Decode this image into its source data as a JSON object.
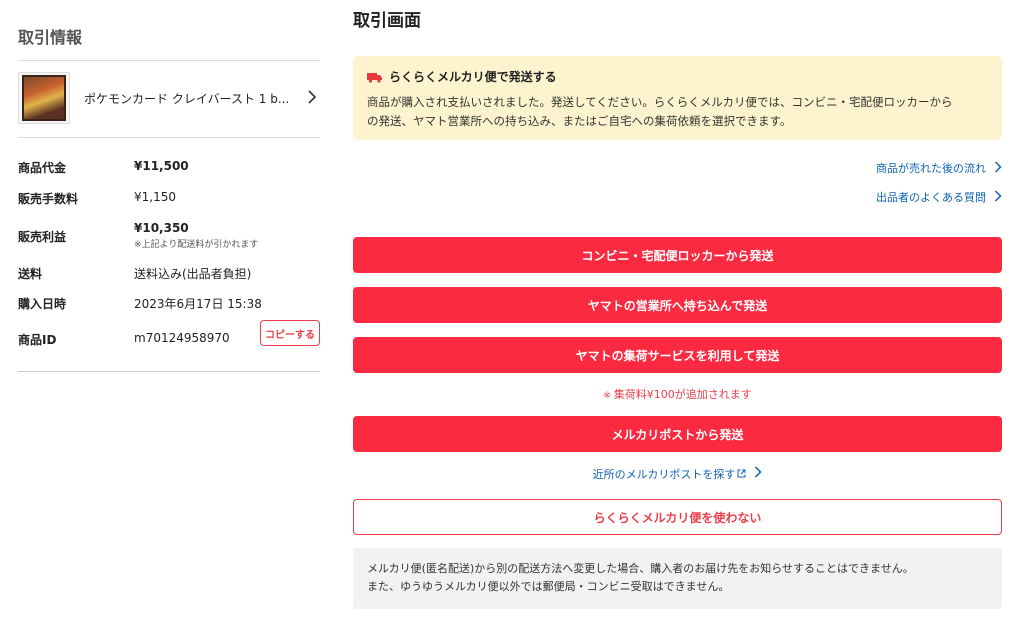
{
  "left": {
    "title": "取引情報",
    "product": {
      "name": "ポケモンカード クレイバースト 1 b...",
      "chevron": "chevron-right-icon"
    },
    "rows": {
      "price": {
        "label": "商品代金",
        "value": "¥11,500"
      },
      "fee": {
        "label": "販売手数料",
        "value": "¥1,150"
      },
      "profit": {
        "label": "販売利益",
        "value": "¥10,350",
        "note": "※上記より配送料が引かれます"
      },
      "shipping": {
        "label": "送料",
        "value": "送料込み(出品者負担)"
      },
      "purchase_date": {
        "label": "購入日時",
        "value": "2023年6月17日 15:38"
      },
      "item_id": {
        "label": "商品ID",
        "value": "m70124958970",
        "copy_label": "コピーする"
      }
    }
  },
  "right": {
    "title": "取引画面",
    "notice": {
      "icon": "truck-icon",
      "heading": "らくらくメルカリ便で発送する",
      "line1": "商品が購入され支払いされました。発送してください。らくらくメルカリ便では、コンビニ・宅配便ロッカーから",
      "line2": "の発送、ヤマト営業所への持ち込み、またはご自宅への集荷依頼を選択できます。"
    },
    "links": {
      "flow": "商品が売れた後の流れ",
      "faq": "出品者のよくある質問"
    },
    "buttons": {
      "convenience": "コンビニ・宅配便ロッカーから発送",
      "yamato_office": "ヤマトの営業所へ持ち込んで発送",
      "yamato_pickup": "ヤマトの集荷サービスを利用して発送",
      "mercari_post": "メルカリポストから発送",
      "no_rakuraku": "らくらくメルカリ便を使わない"
    },
    "pickup_note": {
      "mark": "※",
      "text": "集荷料¥100が追加されます"
    },
    "post_link": "近所のメルカリポストを探す",
    "info": {
      "line1": "メルカリ便(匿名配送)から別の配送方法へ変更した場合、購入者のお届け先をお知らせすることはできません。",
      "line2": "また、ゆうゆうメルカリ便以外では郵便局・コンビニ受取はできません。"
    },
    "colors": {
      "accent": "#fb2a40",
      "notice_bg": "#fdf4cf",
      "link": "#0f62b4"
    }
  }
}
